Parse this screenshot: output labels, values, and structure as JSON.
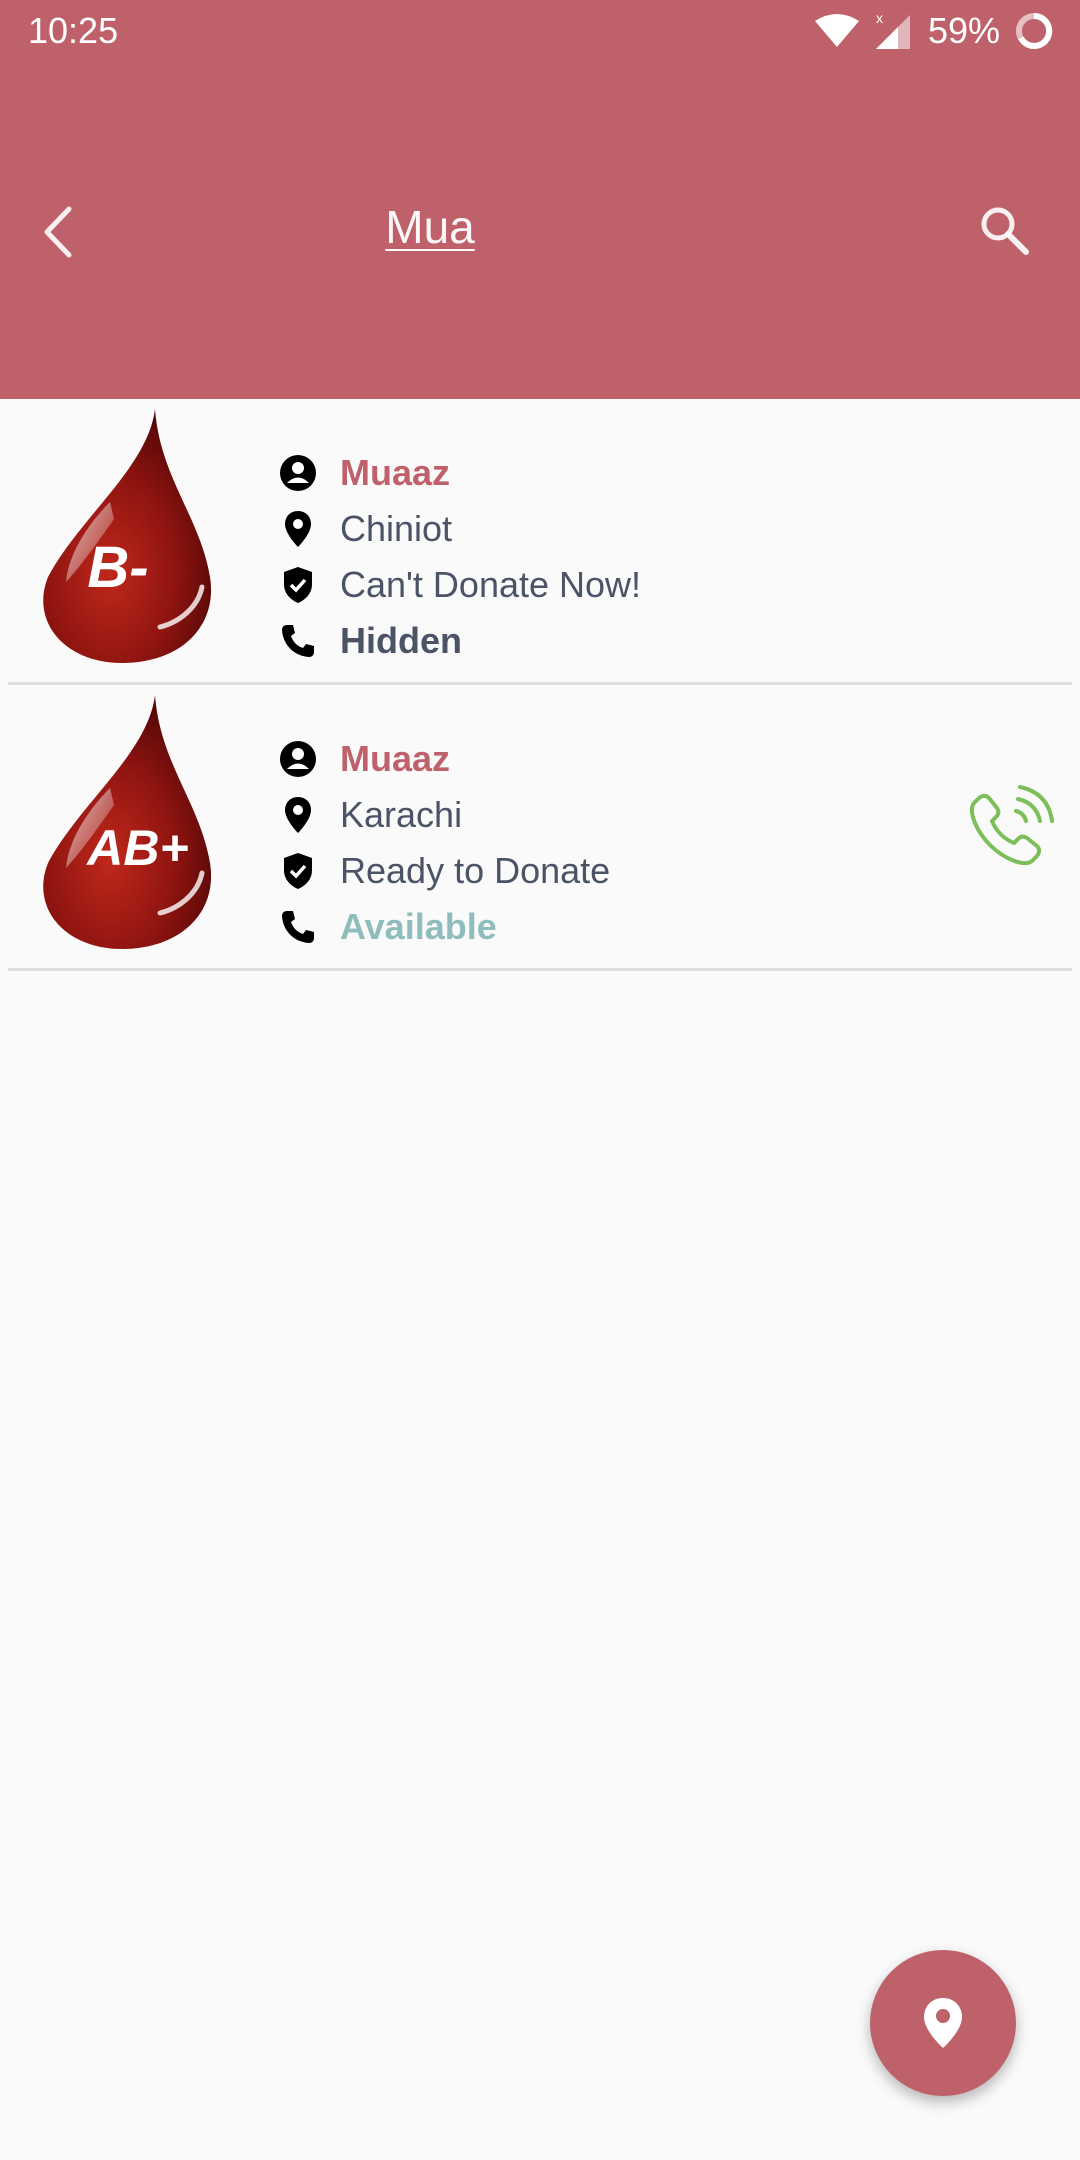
{
  "status_bar": {
    "time": "10:25",
    "battery_percent": "59%",
    "icons": [
      "wifi-icon",
      "signal-icon",
      "battery-icon"
    ]
  },
  "toolbar": {
    "search_query": "Mua",
    "back_icon": "chevron-left-icon",
    "search_icon": "search-icon"
  },
  "colors": {
    "primary": "#be616a",
    "text": "#4b5366",
    "available": "#8fbcbc",
    "call": "#7cbf5a"
  },
  "donors": [
    {
      "blood_group": "B-",
      "name": "Muaaz",
      "city": "Chiniot",
      "status": "Can't Donate Now!",
      "phone": "Hidden",
      "callable": false
    },
    {
      "blood_group": "AB+",
      "name": "Muaaz",
      "city": "Karachi",
      "status": "Ready to Donate",
      "phone": "Available",
      "callable": true
    }
  ],
  "fab": {
    "icon": "location-pin-icon"
  }
}
